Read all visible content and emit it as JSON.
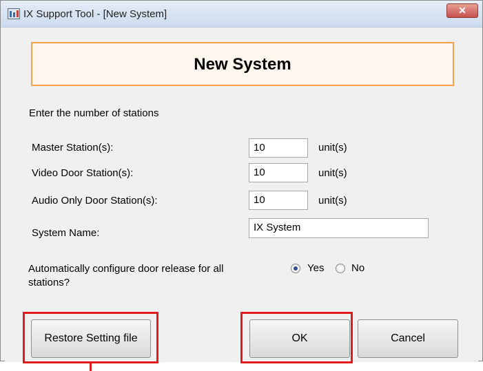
{
  "window": {
    "title": "IX Support Tool - [New System]",
    "close_glyph": "✕"
  },
  "header": {
    "title": "New System"
  },
  "form": {
    "intro": "Enter the number of stations",
    "unit_label": "unit(s)",
    "fields": [
      {
        "label": "Master Station(s):",
        "value": "10"
      },
      {
        "label": "Video Door Station(s):",
        "value": "10"
      },
      {
        "label": "Audio Only Door Station(s):",
        "value": "10"
      }
    ],
    "system_name": {
      "label": "System Name:",
      "value": "IX System"
    },
    "door_release": {
      "question_line1": "Automatically configure door release for all",
      "question_line2": "stations?",
      "options": [
        {
          "label": "Yes",
          "checked": true
        },
        {
          "label": "No",
          "checked": false
        }
      ]
    }
  },
  "buttons": {
    "restore": "Restore Setting file",
    "ok": "OK",
    "cancel": "Cancel"
  },
  "annotations": {
    "highlight_color": "#e01b1b",
    "header_border_color": "#f5a04a"
  }
}
